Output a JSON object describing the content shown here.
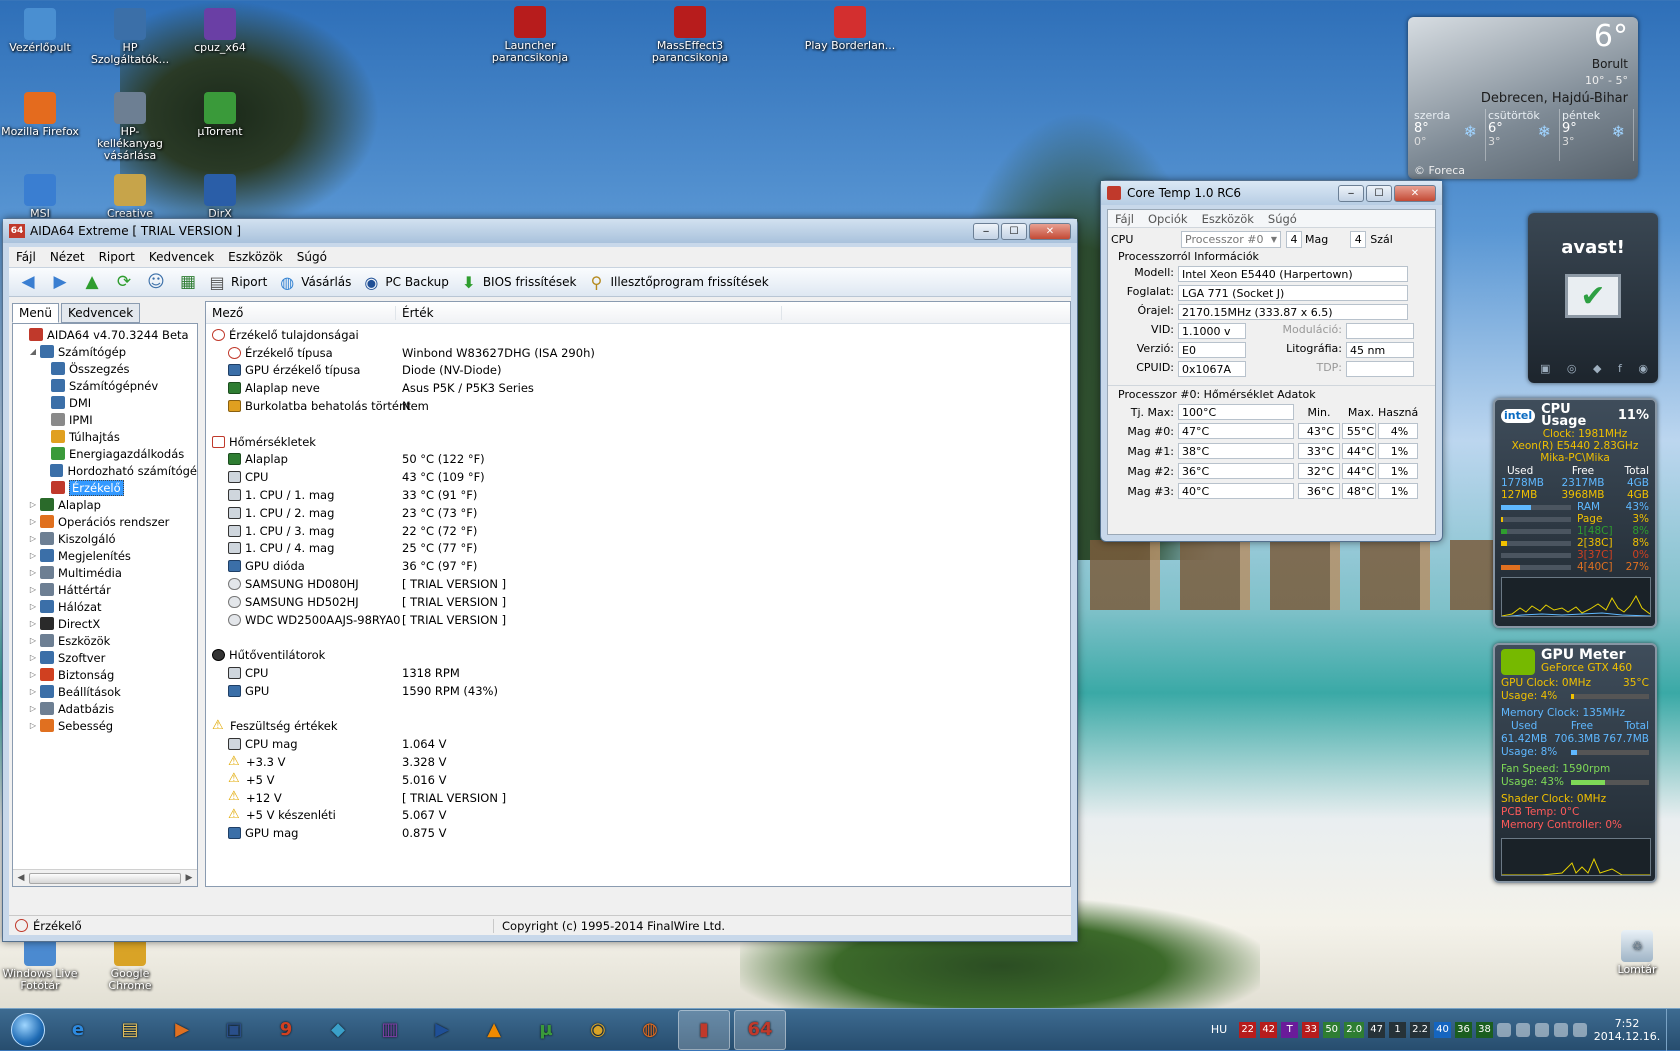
{
  "desktop": {
    "icons_left": [
      {
        "label": "Vezérlőpult",
        "color": "#4a8fd1"
      },
      {
        "label": "HP Szolgáltatók...",
        "color": "#3b6fa8"
      },
      {
        "label": "cpuz_x64",
        "color": "#6a3fa5"
      },
      {
        "label": "Mozilla Firefox",
        "color": "#e46b1e"
      },
      {
        "label": "HP-kellékanyag vásárlása",
        "color": "#6d7f93"
      },
      {
        "label": "µTorrent",
        "color": "#3a9a3a"
      },
      {
        "label": "MSI",
        "color": "#3a7ed1"
      },
      {
        "label": "Creative",
        "color": "#c7a44a"
      },
      {
        "label": "DirX",
        "color": "#2a5ea8"
      },
      {
        "label": "Windows Live Fotótár",
        "color": "#4b8ad0"
      },
      {
        "label": "Google Chrome",
        "color": "#d9a326"
      }
    ],
    "icons_top": [
      {
        "label": "Launcher parancsikonja",
        "color": "#b71c1c"
      },
      {
        "label": "MassEffect3 parancsikonja",
        "color": "#b71c1c"
      },
      {
        "label": "Play Borderlan...",
        "color": "#d32f2f"
      }
    ],
    "recycle": {
      "label": "Lomtár"
    }
  },
  "aida": {
    "title": "AIDA64 Extreme  [ TRIAL VERSION ]",
    "menu": [
      "Fájl",
      "Nézet",
      "Riport",
      "Kedvencek",
      "Eszközök",
      "Súgó"
    ],
    "toolbar": [
      "Riport",
      "Vásárlás",
      "PC Backup",
      "BIOS frissítések",
      "Illesztőprogram frissítések"
    ],
    "tabs": [
      "Menü",
      "Kedvencek"
    ],
    "tree": [
      {
        "label": "AIDA64 v4.70.3244 Beta",
        "level": 0,
        "toggle": "",
        "color": "#c0392b"
      },
      {
        "label": "Számítógép",
        "level": 1,
        "toggle": "◢",
        "color": "#3b6fa8"
      },
      {
        "label": "Összegzés",
        "level": 2,
        "toggle": "",
        "color": "#3b6fa8"
      },
      {
        "label": "Számítógépnév",
        "level": 2,
        "toggle": "",
        "color": "#3b6fa8"
      },
      {
        "label": "DMI",
        "level": 2,
        "toggle": "",
        "color": "#3b6fa8"
      },
      {
        "label": "IPMI",
        "level": 2,
        "toggle": "",
        "color": "#8a8a8a"
      },
      {
        "label": "Túlhajtás",
        "level": 2,
        "toggle": "",
        "color": "#e0a020"
      },
      {
        "label": "Energiagazdálkodás",
        "level": 2,
        "toggle": "",
        "color": "#3a9a3a"
      },
      {
        "label": "Hordozható számítógé",
        "level": 2,
        "toggle": "",
        "color": "#3b6fa8"
      },
      {
        "label": "Érzékelő",
        "level": 2,
        "toggle": "",
        "color": "#c0392b",
        "selected": true
      },
      {
        "label": "Alaplap",
        "level": 1,
        "toggle": "▷",
        "color": "#2a6a2a"
      },
      {
        "label": "Operációs rendszer",
        "level": 1,
        "toggle": "▷",
        "color": "#e0701e"
      },
      {
        "label": "Kiszolgáló",
        "level": 1,
        "toggle": "▷",
        "color": "#6d7f93"
      },
      {
        "label": "Megjelenítés",
        "level": 1,
        "toggle": "▷",
        "color": "#3b6fa8"
      },
      {
        "label": "Multimédia",
        "level": 1,
        "toggle": "▷",
        "color": "#6d7f93"
      },
      {
        "label": "Háttértár",
        "level": 1,
        "toggle": "▷",
        "color": "#6d7f93"
      },
      {
        "label": "Hálózat",
        "level": 1,
        "toggle": "▷",
        "color": "#3b6fa8"
      },
      {
        "label": "DirectX",
        "level": 1,
        "toggle": "▷",
        "color": "#2a2a2a"
      },
      {
        "label": "Eszközök",
        "level": 1,
        "toggle": "▷",
        "color": "#6d7f93"
      },
      {
        "label": "Szoftver",
        "level": 1,
        "toggle": "▷",
        "color": "#3b6fa8"
      },
      {
        "label": "Biztonság",
        "level": 1,
        "toggle": "▷",
        "color": "#d04020"
      },
      {
        "label": "Beállítások",
        "level": 1,
        "toggle": "▷",
        "color": "#3b6fa8"
      },
      {
        "label": "Adatbázis",
        "level": 1,
        "toggle": "▷",
        "color": "#6d7f93"
      },
      {
        "label": "Sebesség",
        "level": 1,
        "toggle": "▷",
        "color": "#e07020"
      }
    ],
    "columns": [
      "Mező",
      "Érték"
    ],
    "rows": [
      {
        "field": "Érzékelő tulajdonságai",
        "value": "",
        "group": true,
        "icon": "sensor"
      },
      {
        "field": "Érzékelő típusa",
        "value": "Winbond W83627DHG  (ISA 290h)",
        "icon": "sensor"
      },
      {
        "field": "GPU érzékelő típusa",
        "value": "Diode  (NV-Diode)",
        "icon": "gpu"
      },
      {
        "field": "Alaplap neve",
        "value": "Asus P5K / P5K3 Series",
        "icon": "mb"
      },
      {
        "field": "Burkolatba behatolás történt",
        "value": "Nem",
        "icon": "lock"
      },
      {
        "field": "",
        "value": "",
        "spacer": true
      },
      {
        "field": "Hőmérsékletek",
        "value": "",
        "group": true,
        "icon": "temp"
      },
      {
        "field": "Alaplap",
        "value": "50 °C  (122 °F)",
        "icon": "mb"
      },
      {
        "field": "CPU",
        "value": "43 °C  (109 °F)",
        "icon": "cpu"
      },
      {
        "field": "1. CPU / 1. mag",
        "value": "33 °C  (91 °F)",
        "icon": "cpu"
      },
      {
        "field": "1. CPU / 2. mag",
        "value": "23 °C  (73 °F)",
        "icon": "cpu"
      },
      {
        "field": "1. CPU / 3. mag",
        "value": "22 °C  (72 °F)",
        "icon": "cpu"
      },
      {
        "field": "1. CPU / 4. mag",
        "value": "25 °C  (77 °F)",
        "icon": "cpu"
      },
      {
        "field": "GPU dióda",
        "value": "36 °C  (97 °F)",
        "icon": "gpu"
      },
      {
        "field": "SAMSUNG HD080HJ",
        "value": "[ TRIAL VERSION ]",
        "icon": "hdd"
      },
      {
        "field": "SAMSUNG HD502HJ",
        "value": "[ TRIAL VERSION ]",
        "icon": "hdd"
      },
      {
        "field": "WDC WD2500AAJS-98RYA0",
        "value": "[ TRIAL VERSION ]",
        "icon": "hdd"
      },
      {
        "field": "",
        "value": "",
        "spacer": true
      },
      {
        "field": "Hűtőventilátorok",
        "value": "",
        "group": true,
        "icon": "fan"
      },
      {
        "field": "CPU",
        "value": "1318 RPM",
        "icon": "cpu"
      },
      {
        "field": "GPU",
        "value": "1590 RPM  (43%)",
        "icon": "gpu"
      },
      {
        "field": "",
        "value": "",
        "spacer": true
      },
      {
        "field": "Feszültség értékek",
        "value": "",
        "group": true,
        "icon": "warn"
      },
      {
        "field": "CPU mag",
        "value": "1.064 V",
        "icon": "cpu"
      },
      {
        "field": "+3.3 V",
        "value": "3.328 V",
        "icon": "warn"
      },
      {
        "field": "+5 V",
        "value": "5.016 V",
        "icon": "warn"
      },
      {
        "field": "+12 V",
        "value": "[ TRIAL VERSION ]",
        "icon": "warn"
      },
      {
        "field": "+5 V készenléti",
        "value": "5.067 V",
        "icon": "warn"
      },
      {
        "field": "GPU mag",
        "value": "0.875 V",
        "icon": "gpu"
      }
    ],
    "status_left": "Érzékelő",
    "status_right": "Copyright (c) 1995-2014 FinalWire Ltd."
  },
  "coretemp": {
    "title": "Core Temp 1.0 RC6",
    "menu": [
      "Fájl",
      "Opciók",
      "Eszközök",
      "Súgó"
    ],
    "cpu_label": "CPU",
    "processor_select": "Processzor #0",
    "cores_value": "4",
    "cores_label": "Mag",
    "threads_value": "4",
    "threads_label": "Szál",
    "info_title": "Processzorról Információk",
    "model_label": "Modell:",
    "model": "Intel Xeon E5440 (Harpertown)",
    "socket_label": "Foglalat:",
    "socket": "LGA 771 (Socket J)",
    "clock_label": "Órajel:",
    "clock": "2170.15MHz (333.87 x 6.5)",
    "vid_label": "VID:",
    "vid": "1.1000 v",
    "mod_label": "Moduláció:",
    "rev_label": "Verzió:",
    "rev": "E0",
    "litho_label": "Litográfia:",
    "litho": "45 nm",
    "cpuid_label": "CPUID:",
    "cpuid": "0x1067A",
    "tdp_label": "TDP:",
    "temp_title": "Processzor #0: Hőmérséklet Adatok",
    "tjmax_label": "Tj. Max:",
    "tjmax": "100°C",
    "col_min": "Min.",
    "col_max": "Max.",
    "col_load": "Használat",
    "cores": [
      {
        "label": "Mag #0:",
        "temp": "47°C",
        "min": "43°C",
        "max": "55°C",
        "load": "4%"
      },
      {
        "label": "Mag #1:",
        "temp": "38°C",
        "min": "33°C",
        "max": "44°C",
        "load": "1%"
      },
      {
        "label": "Mag #2:",
        "temp": "36°C",
        "min": "32°C",
        "max": "44°C",
        "load": "1%"
      },
      {
        "label": "Mag #3:",
        "temp": "40°C",
        "min": "36°C",
        "max": "48°C",
        "load": "1%"
      }
    ]
  },
  "weather": {
    "temp": "6°",
    "cond": "Borult",
    "range": "10° - 5°",
    "city": "Debrecen, Hajdú-Bihar",
    "days": [
      {
        "name": "szerda",
        "hi": "8°",
        "lo": "0°"
      },
      {
        "name": "csütörtök",
        "hi": "6°",
        "lo": "3°"
      },
      {
        "name": "péntek",
        "hi": "9°",
        "lo": "3°"
      }
    ],
    "credit": "© Foreca"
  },
  "avast": {
    "brand": "avast!"
  },
  "cpu_gadget": {
    "title": "CPU Usage",
    "pct": "11%",
    "clock": "Clock: 1981MHz",
    "model": "Xeon(R) E5440 2.83GHz",
    "host": "Mika-PC\\Mika",
    "h_used": "Used",
    "h_free": "Free",
    "h_total": "Total",
    "ram": {
      "used": "1778MB",
      "free": "2317MB",
      "total": "4GB"
    },
    "page": {
      "used": "127MB",
      "free": "3968MB",
      "total": "4GB"
    },
    "bars": [
      {
        "label": "RAM",
        "pct": "43%",
        "level": 0.43
      },
      {
        "label": "Page",
        "pct": "3%",
        "level": 0.03
      },
      {
        "label": "1[48C]",
        "pct": "8%",
        "level": 0.08
      },
      {
        "label": "2[38C]",
        "pct": "8%",
        "level": 0.08
      },
      {
        "label": "3[37C]",
        "pct": "0%",
        "level": 0.0
      },
      {
        "label": "4[40C]",
        "pct": "27%",
        "level": 0.27
      }
    ]
  },
  "gpu_gadget": {
    "title": "GPU Meter",
    "card": "GeForce GTX 460",
    "gpu_clock": "GPU Clock: 0MHz",
    "gpu_temp": "35°C",
    "usage1": "Usage: 4%",
    "usage1_level": 0.04,
    "mem_clock": "Memory Clock: 135MHz",
    "h_used": "Used",
    "h_free": "Free",
    "h_total": "Total",
    "mem_used": "61.42MB",
    "mem_free": "706.3MB",
    "mem_total": "767.7MB",
    "usage2": "Usage: 8%",
    "usage2_level": 0.08,
    "fan": "Fan Speed: 1590rpm",
    "usage3": "Usage: 43%",
    "usage3_level": 0.43,
    "shader": "Shader Clock: 0MHz",
    "pcb": "PCB Temp: 0°C",
    "memctl": "Memory Controller: 0%"
  },
  "taskbar": {
    "lang": "HU",
    "tray": [
      {
        "t": "22",
        "c": "#b71c1c"
      },
      {
        "t": "42",
        "c": "#b71c1c"
      },
      {
        "t": "T",
        "c": "#6a1b9a"
      },
      {
        "t": "33",
        "c": "#b71c1c"
      },
      {
        "t": "50",
        "c": "#2e7d32"
      },
      {
        "t": "2.0",
        "c": "#2e7d32"
      },
      {
        "t": "47",
        "c": "#263238"
      },
      {
        "t": "1",
        "c": "#263238"
      },
      {
        "t": "2.2",
        "c": "#263238"
      },
      {
        "t": "40",
        "c": "#1565c0"
      },
      {
        "t": "36",
        "c": "#1b5e20"
      },
      {
        "t": "38",
        "c": "#1b5e20"
      }
    ],
    "time": "7:52",
    "date": "2014.12.16."
  }
}
